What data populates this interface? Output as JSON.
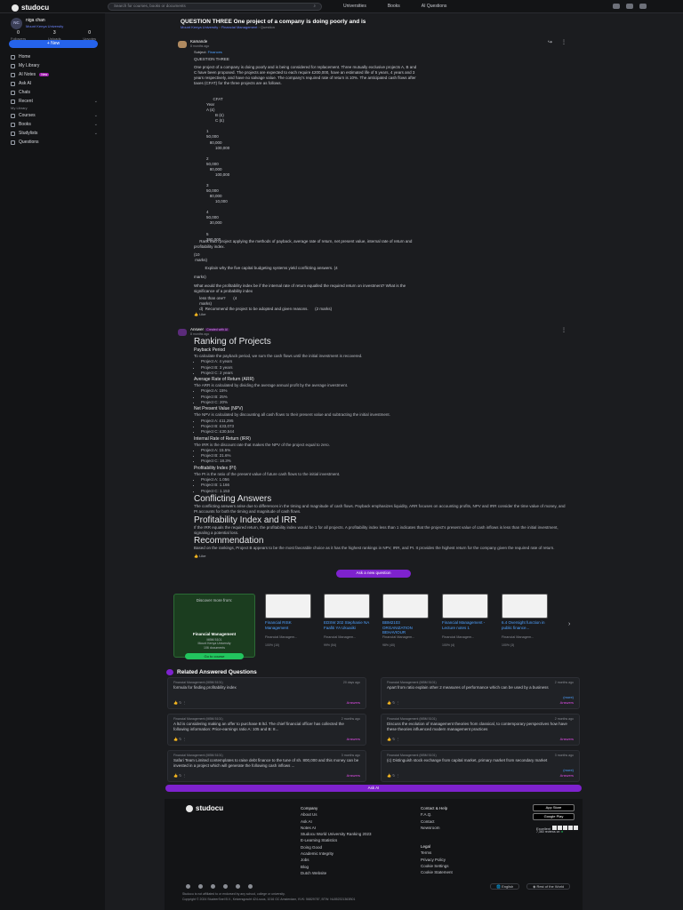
{
  "topbar": {
    "logo": "studocu",
    "search_placeholder": "Search for courses, books or documents",
    "nav": [
      "Universities",
      "Books",
      "AI Questions"
    ]
  },
  "sidebar": {
    "profile": {
      "initials": "NC",
      "name": "niga chan",
      "university": "Mount Kenya University"
    },
    "stats": [
      {
        "value": "0",
        "label": "Followers"
      },
      {
        "value": "3",
        "label": "Uploads"
      },
      {
        "value": "0",
        "label": "Upvotes"
      }
    ],
    "new_label": "+ New",
    "items": [
      {
        "label": "Home"
      },
      {
        "label": "My Library"
      },
      {
        "label": "AI Notes",
        "badge": "New"
      },
      {
        "label": "Ask AI"
      },
      {
        "label": "Chats"
      },
      {
        "label": "Recent",
        "chevron": true
      },
      {
        "section": "My Library"
      },
      {
        "label": "Courses",
        "chevron": true
      },
      {
        "label": "Books",
        "chevron": true
      },
      {
        "label": "Studylists",
        "chevron": true
      },
      {
        "label": "Questions"
      }
    ]
  },
  "question": {
    "title": "QUESTION THREE One project of a company is doing poorly and is",
    "crumbs": [
      "Mount Kenya University",
      "Financial Management",
      "Question"
    ],
    "author": "Kamande",
    "time": "8 months ago",
    "subject_label": "Subject:",
    "subject": "Finances",
    "heading": "QUESTION THREE",
    "intro": "One project of a company is doing poorly and is being considered for replacement. Three mutually exclusive projects A, B and\nC have been proposed. The projects are expected to each require £200,000, have an estimated life of 5 years, 4 years and 3\nyears respectively, and have no salvage value. The company's required rate of return is 10%. The anticipated cash flows after\ntaxes (CFAT) for the three projects are as follows.",
    "table_text": "      CFAT\nYear\nA (£)\n        B (£)\n        C (£)\n\n1\n50,000\n   80,000\n        100,000\n\n2\n50,000\n   80,000\n        100,000\n\n3\n50,000\n   80,000\n        10,000\n\n4\n50,000\n   30,000\n\n5\n390,000",
    "part_a": "     Rank each project applying the methods of payback, average rate of return, net present value, internal rate of return and\nprofitability index.",
    "marks_10": "(10\n marks)",
    "part_b": "          Explain why the five capital budgeting systems yield conflicting answers. (4",
    "marks_b": "marks)",
    "part_c": "What would the profitability index be if the internal rate of return equalled the required return on investment? What is the\nsignificance of a probability index",
    "part_c2": "     less than one?       (4\n     marks)\n     d)  Recommend the project to be adopted and given reasons.      (2 marks)",
    "like": "Like"
  },
  "answer": {
    "author": "Answer",
    "ai_label": "Created with AI",
    "time": "8 months ago",
    "h_ranking": "Ranking of Projects",
    "payback_h": "Payback Period",
    "payback_p": "To calculate the payback period, we sum the cash flows until the initial investment is recovered.",
    "payback_list": [
      "Project A: 4 years",
      "Project B: 3 years",
      "Project C: 2 years"
    ],
    "arr_h": "Average Rate of Return (ARR)",
    "arr_p": "The ARR is calculated by dividing the average annual profit by the average investment.",
    "arr_list": [
      "Project A: 15%",
      "Project B: 25%",
      "Project C: 20%"
    ],
    "npv_h": "Net Present Value (NPV)",
    "npv_p": "The NPV is calculated by discounting all cash flows to their present value and subtracting the initial investment.",
    "npv_list": [
      "Project A: £11,295",
      "Project B: £33,073",
      "Project C: £30,544"
    ],
    "irr_h": "Internal Rate of Return (IRR)",
    "irr_p": "The IRR is the discount rate that makes the NPV of the project equal to zero.",
    "irr_list": [
      "Project A: 15.5%",
      "Project B: 21.6%",
      "Project C: 18.3%"
    ],
    "pi_h": "Profitability Index (PI)",
    "pi_p": "The PI is the ratio of the present value of future cash flows to the initial investment.",
    "pi_list": [
      "Project A: 1.056",
      "Project B: 1.166",
      "Project C: 1.153"
    ],
    "h_conflict": "Conflicting Answers",
    "conflict_p": "The conflicting answers arise due to differences in the timing and magnitude of cash flows. Payback emphasizes liquidity, ARR focuses on accounting profits, NPV and IRR consider the time value of money, and PI accounts for both the timing and magnitude of cash flows.",
    "h_pi_irr": "Profitability Index and IRR",
    "pi_irr_p": "If the IRR equals the required return, the profitability index would be 1 for all projects. A profitability index less than 1 indicates that the project's present value of cash inflows is less than the initial investment, signaling a potential loss.",
    "h_rec": "Recommendation",
    "rec_p": "Based on the rankings, Project B appears to be the most favorable choice as it has the highest rankings in NPV, IRR, and PI. It provides the highest return for the company given the required rate of return.",
    "like": "Like"
  },
  "ask_new": "Ask a new question",
  "discover": {
    "title": "Discover more from:",
    "course": "Financial Management",
    "code": "MBM 5101",
    "meta1": "Mount Kenya University",
    "meta2": "106 documents",
    "button": "Go to course"
  },
  "docs": [
    {
      "title": "Financial RISK Management",
      "course": "Financial Managem...",
      "rating": "100% (10)",
      "pages": "47"
    },
    {
      "title": "EDSW 202 Stephanie NA Faafiti YA Ukuaiiki",
      "course": "Financial Managem...",
      "rating": "99% (54)",
      "pages": "44"
    },
    {
      "title": "BBM2103 ORGANIZATION BEHAVIOUR",
      "course": "Financial Managem...",
      "rating": "98% (40)",
      "pages": "100"
    },
    {
      "title": "Financial Management - Lecture notes 1",
      "course": "Financial Managem...",
      "rating": "100% (4)",
      "pages": "11"
    },
    {
      "title": "6.4 Oversight function in public finance...",
      "course": "Financial Managem...",
      "rating": "100% (3)",
      "pages": "8"
    }
  ],
  "related": {
    "title": "Related Answered Questions",
    "items": [
      {
        "course": "Financial Management (MBM 5101)",
        "time": "20 days ago",
        "text": "formula for finding profitability index",
        "answers": "Answers"
      },
      {
        "course": "Financial Management (MBM 5101)",
        "time": "2 months ago",
        "text": "Apart from ratio explain other 2 measures of performance which can be used by a business",
        "answers": "Answers",
        "more": "(more)"
      },
      {
        "course": "Financial Management (MBM 5101)",
        "time": "2 months ago",
        "text": "A ltd is considering making an offer to purchase B ltd. The chief financial officer has collected the following information: Price-earnings ratio   A: 105 and B: 8...",
        "answers": "Answers"
      },
      {
        "course": "Financial Management (MBM 5101)",
        "time": "2 months ago",
        "text": "Discuss the evolution of management theories from classical, to contemporary perspectives how have these theories influenced modern management  practices",
        "answers": "Answers"
      },
      {
        "course": "Financial Management (MBM 5101)",
        "time": "3 months ago",
        "text": "Safari Team Limited contemplates to raise debt finance to the tune of sh. 800,000 and this money can be invested in a project which will generate the following cash inflows ...",
        "answers": "Answers"
      },
      {
        "course": "Financial Management (MBM 5101)",
        "time": "3 months ago",
        "text": "(c) Distinguish stock exchange from capital market, primary market from secondary market",
        "answers": "Answers",
        "more": "(more)"
      }
    ]
  },
  "ask_ai": "Ask AI",
  "footer": {
    "logo": "studocu",
    "company_h": "Company",
    "company": [
      "About Us",
      "Ask AI",
      "Notes AI",
      "Studocu World University Ranking 2023",
      "E-Learning Statistics",
      "Doing Good",
      "Academic Integrity",
      "Jobs",
      "Blog",
      "Dutch Website"
    ],
    "contact_h": "Contact & Help",
    "contact": [
      "F.A.Q.",
      "Contact",
      "Newsroom"
    ],
    "legal_h": "Legal",
    "legal": [
      "Terms",
      "Privacy Policy",
      "Cookie Settings",
      "Cookie Statement"
    ],
    "app_store": "App Store",
    "google_play": "Google Play",
    "trust_label": "Excellent",
    "reviews": "7,360 reviews on",
    "lang": "English",
    "region": "Rest of the World",
    "disclaimer": "Studocu is not affiliated to or endorsed by any school, college or university.",
    "copyright": "Copyright © 2024 StudeerSnel B.V., Keizersgracht 424-sous, 1016 GC Amsterdam, KVK: 56829787, BTW: NL852321363B01"
  }
}
